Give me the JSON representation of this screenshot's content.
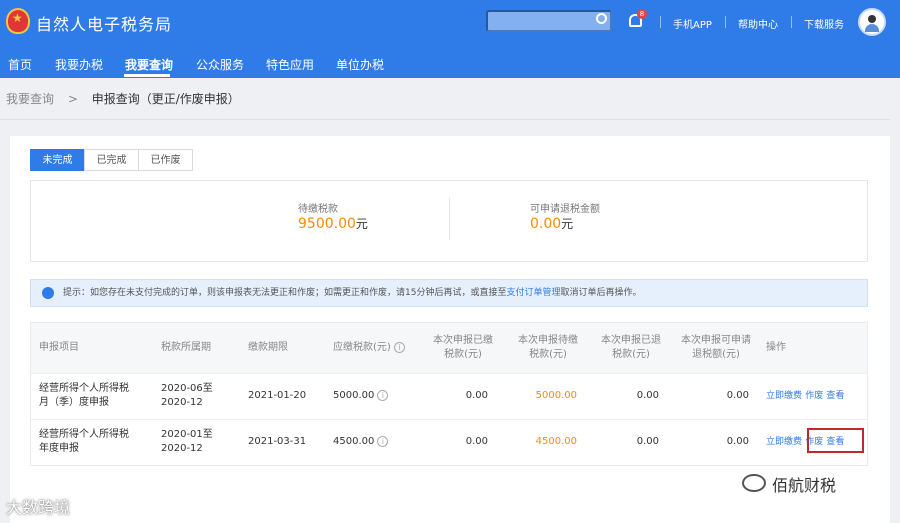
{
  "header": {
    "site_title": "自然人电子税务局",
    "search": {
      "placeholder": ""
    },
    "notification_count": "8",
    "links": [
      "手机APP",
      "帮助中心",
      "下载服务"
    ]
  },
  "nav": {
    "items": [
      "首页",
      "我要办税",
      "我要查询",
      "公众服务",
      "特色应用",
      "单位办税"
    ],
    "active": "我要查询"
  },
  "breadcrumb": {
    "parent": "我要查询",
    "separator": ">",
    "current": "申报查询（更正/作废申报）"
  },
  "tabs": [
    "未完成",
    "已完成",
    "已作废"
  ],
  "summary": {
    "pending_label": "待缴税款",
    "pending_value": "9500.00",
    "refund_label": "可申请退税金额",
    "refund_value": "0.00",
    "unit": "元"
  },
  "notice": {
    "prefix": "提示：如您存在未支付完成的订单，则该申报表无法更正和作废；如需更正和作废，请15分钟后再试，或直接至",
    "link": "支付订单管理",
    "suffix": "取消订单后再操作。"
  },
  "table": {
    "columns": {
      "project": "申报项目",
      "period": "税款所属期",
      "deadline": "缴款期限",
      "payable": "应缴税款(元)",
      "paid_1": "本次申报已缴",
      "paid_2": "税款(元)",
      "topay_1": "本次申报待缴",
      "topay_2": "税款(元)",
      "refunded_1": "本次申报已退",
      "refunded_2": "税款(元)",
      "refundable_1": "本次申报可申请",
      "refundable_2": "退税额(元)",
      "ops": "操作"
    },
    "rows": [
      {
        "project_1": "经营所得个人所得税",
        "project_2": "月（季）度申报",
        "period_1": "2020-06至",
        "period_2": "2020-12",
        "deadline": "2021-01-20",
        "payable": "5000.00",
        "paid": "0.00",
        "topay": "5000.00",
        "refunded": "0.00",
        "refundable": "0.00",
        "act_pay": "立即缴费",
        "act_void": "作废",
        "act_view": "查看"
      },
      {
        "project_1": "经营所得个人所得税",
        "project_2": "年度申报",
        "period_1": "2020-01至",
        "period_2": "2020-12",
        "deadline": "2021-03-31",
        "payable": "4500.00",
        "paid": "0.00",
        "topay": "4500.00",
        "refunded": "0.00",
        "refundable": "0.00",
        "act_pay": "立即缴费",
        "act_void": "作废",
        "act_view": "查看"
      }
    ]
  },
  "watermarks": {
    "left": "大数跨境",
    "right": "佰航财税"
  },
  "colors": {
    "primary": "#2f7ce9",
    "accent_orange": "#ff8a00",
    "highlight_red": "#c0282d"
  }
}
